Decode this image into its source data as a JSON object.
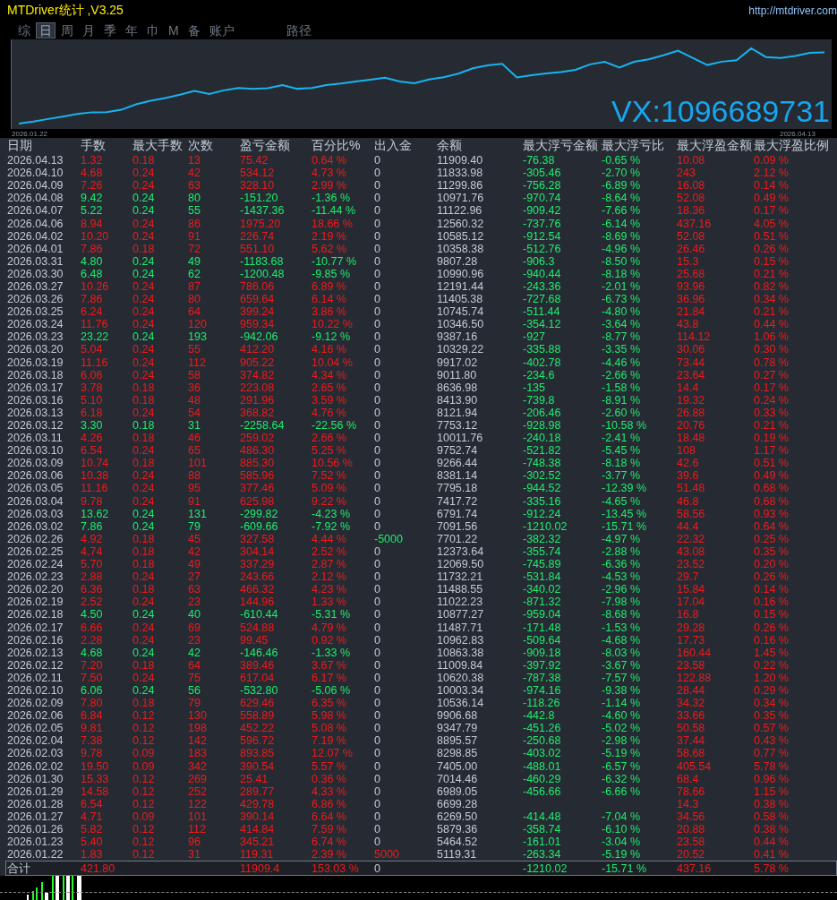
{
  "window": {
    "title": "MTDriver统计 ,V3.25",
    "url": "http://mtdriver.com"
  },
  "tabs": [
    {
      "label": "综",
      "selected": false
    },
    {
      "label": "日",
      "selected": true
    },
    {
      "label": "周",
      "selected": false
    },
    {
      "label": "月",
      "selected": false
    },
    {
      "label": "季",
      "selected": false
    },
    {
      "label": "年",
      "selected": false
    },
    {
      "label": "巾",
      "selected": false
    },
    {
      "label": "M",
      "selected": false
    },
    {
      "label": "备",
      "selected": false
    },
    {
      "label": "账户",
      "selected": false
    }
  ],
  "path_label": "路径",
  "chart": {
    "start_label": "2026.01.22",
    "end_label": "2026.04.13",
    "contact": "VX:1096689731"
  },
  "table": {
    "columns": [
      "日期",
      "手数",
      "最大手数",
      "次数",
      "盈亏金额",
      "百分比%",
      "出入金",
      "余额",
      "最大浮亏金额",
      "最大浮亏比",
      "最大浮盈金额",
      "最大浮盈比例"
    ],
    "rows": [
      {
        "kind": "win",
        "cells": [
          "2026.04.13",
          "1.32",
          "0.18",
          "13",
          "75.42",
          "0.64 %",
          "0",
          "11909.40",
          "-76.38",
          "-0.65 %",
          "10.08",
          "0.09 %"
        ]
      },
      {
        "kind": "win",
        "cells": [
          "2026.04.10",
          "4.68",
          "0.24",
          "42",
          "534.12",
          "4.73 %",
          "0",
          "11833.98",
          "-305.46",
          "-2.70 %",
          "243",
          "2.12 %"
        ]
      },
      {
        "kind": "win",
        "cells": [
          "2026.04.09",
          "7.26",
          "0.24",
          "63",
          "328.10",
          "2.99 %",
          "0",
          "11299.86",
          "-756.28",
          "-6.89 %",
          "16.08",
          "0.14 %"
        ]
      },
      {
        "kind": "loss",
        "cells": [
          "2026.04.08",
          "9.42",
          "0.24",
          "80",
          "-151.20",
          "-1.36 %",
          "0",
          "10971.76",
          "-970.74",
          "-8.64 %",
          "52.08",
          "0.49 %"
        ]
      },
      {
        "kind": "loss",
        "cells": [
          "2026.04.07",
          "5.22",
          "0.24",
          "55",
          "-1437.36",
          "-11.44 %",
          "0",
          "11122.96",
          "-909.42",
          "-7.66 %",
          "18.36",
          "0.17 %"
        ]
      },
      {
        "kind": "win",
        "cells": [
          "2026.04.06",
          "8.94",
          "0.24",
          "86",
          "1975.20",
          "18.66 %",
          "0",
          "12560.32",
          "-737.76",
          "-6.14 %",
          "437.16",
          "4.05 %"
        ]
      },
      {
        "kind": "win",
        "cells": [
          "2026.04.02",
          "10.20",
          "0.24",
          "91",
          "226.74",
          "2.19 %",
          "0",
          "10585.12",
          "-912.54",
          "-8.69 %",
          "52.08",
          "0.51 %"
        ]
      },
      {
        "kind": "win",
        "cells": [
          "2026.04.01",
          "7.86",
          "0.18",
          "72",
          "551.10",
          "5.62 %",
          "0",
          "10358.38",
          "-512.76",
          "-4.96 %",
          "26.46",
          "0.26 %"
        ]
      },
      {
        "kind": "loss",
        "cells": [
          "2026.03.31",
          "4.80",
          "0.24",
          "49",
          "-1183.68",
          "-10.77 %",
          "0",
          "9807.28",
          "-906.3",
          "-8.50 %",
          "15.3",
          "0.15 %"
        ]
      },
      {
        "kind": "loss",
        "cells": [
          "2026.03.30",
          "6.48",
          "0.24",
          "62",
          "-1200.48",
          "-9.85 %",
          "0",
          "10990.96",
          "-940.44",
          "-8.18 %",
          "25.68",
          "0.21 %"
        ]
      },
      {
        "kind": "win",
        "cells": [
          "2026.03.27",
          "10.26",
          "0.24",
          "87",
          "786.06",
          "6.89 %",
          "0",
          "12191.44",
          "-243.36",
          "-2.01 %",
          "93.96",
          "0.82 %"
        ]
      },
      {
        "kind": "win",
        "cells": [
          "2026.03.26",
          "7.86",
          "0.24",
          "80",
          "659.64",
          "6.14 %",
          "0",
          "11405.38",
          "-727.68",
          "-6.73 %",
          "36.96",
          "0.34 %"
        ]
      },
      {
        "kind": "win",
        "cells": [
          "2026.03.25",
          "6.24",
          "0.24",
          "64",
          "399.24",
          "3.86 %",
          "0",
          "10745.74",
          "-511.44",
          "-4.80 %",
          "21.84",
          "0.21 %"
        ]
      },
      {
        "kind": "win",
        "cells": [
          "2026.03.24",
          "11.76",
          "0.24",
          "120",
          "959.34",
          "10.22 %",
          "0",
          "10346.50",
          "-354.12",
          "-3.64 %",
          "43.8",
          "0.44 %"
        ]
      },
      {
        "kind": "loss",
        "cells": [
          "2026.03.23",
          "23.22",
          "0.24",
          "193",
          "-942.06",
          "-9.12 %",
          "0",
          "9387.16",
          "-927",
          "-8.77 %",
          "114.12",
          "1.06 %"
        ]
      },
      {
        "kind": "win",
        "cells": [
          "2026.03.20",
          "5.04",
          "0.24",
          "55",
          "412.20",
          "4.16 %",
          "0",
          "10329.22",
          "-335.88",
          "-3.35 %",
          "30.06",
          "0.30 %"
        ]
      },
      {
        "kind": "win",
        "cells": [
          "2026.03.19",
          "11.16",
          "0.24",
          "112",
          "905.22",
          "10.04 %",
          "0",
          "9917.02",
          "-402.78",
          "-4.46 %",
          "73.44",
          "0.78 %"
        ]
      },
      {
        "kind": "win",
        "cells": [
          "2026.03.18",
          "6.06",
          "0.24",
          "58",
          "374.82",
          "4.34 %",
          "0",
          "9011.80",
          "-234.6",
          "-2.66 %",
          "23.64",
          "0.27 %"
        ]
      },
      {
        "kind": "win",
        "cells": [
          "2026.03.17",
          "3.78",
          "0.18",
          "36",
          "223.08",
          "2.65 %",
          "0",
          "8636.98",
          "-135",
          "-1.58 %",
          "14.4",
          "0.17 %"
        ]
      },
      {
        "kind": "win",
        "cells": [
          "2026.03.16",
          "5.10",
          "0.18",
          "48",
          "291.96",
          "3.59 %",
          "0",
          "8413.90",
          "-739.8",
          "-8.91 %",
          "19.32",
          "0.24 %"
        ]
      },
      {
        "kind": "win",
        "cells": [
          "2026.03.13",
          "6.18",
          "0.24",
          "54",
          "368.82",
          "4.76 %",
          "0",
          "8121.94",
          "-206.46",
          "-2.60 %",
          "26.88",
          "0.33 %"
        ]
      },
      {
        "kind": "loss",
        "cells": [
          "2026.03.12",
          "3.30",
          "0.18",
          "31",
          "-2258.64",
          "-22.56 %",
          "0",
          "7753.12",
          "-928.98",
          "-10.58 %",
          "20.76",
          "0.21 %"
        ]
      },
      {
        "kind": "win",
        "cells": [
          "2026.03.11",
          "4.26",
          "0.18",
          "46",
          "259.02",
          "2.66 %",
          "0",
          "10011.76",
          "-240.18",
          "-2.41 %",
          "18.48",
          "0.19 %"
        ]
      },
      {
        "kind": "win",
        "cells": [
          "2026.03.10",
          "6.54",
          "0.24",
          "65",
          "486.30",
          "5.25 %",
          "0",
          "9752.74",
          "-521.82",
          "-5.45 %",
          "108",
          "1.17 %"
        ]
      },
      {
        "kind": "win",
        "cells": [
          "2026.03.09",
          "10.74",
          "0.18",
          "101",
          "885.30",
          "10.56 %",
          "0",
          "9266.44",
          "-748.38",
          "-8.18 %",
          "42.6",
          "0.51 %"
        ]
      },
      {
        "kind": "win",
        "cells": [
          "2026.03.06",
          "10.38",
          "0.24",
          "88",
          "585.96",
          "7.52 %",
          "0",
          "8381.14",
          "-302.52",
          "-3.77 %",
          "39.6",
          "0.49 %"
        ]
      },
      {
        "kind": "win",
        "cells": [
          "2026.03.05",
          "11.16",
          "0.24",
          "95",
          "377.46",
          "5.09 %",
          "0",
          "7795.18",
          "-944.52",
          "-12.39 %",
          "51.48",
          "0.68 %"
        ]
      },
      {
        "kind": "win",
        "cells": [
          "2026.03.04",
          "9.78",
          "0.24",
          "91",
          "625.98",
          "9.22 %",
          "0",
          "7417.72",
          "-335.16",
          "-4.65 %",
          "46.8",
          "0.68 %"
        ]
      },
      {
        "kind": "loss",
        "cells": [
          "2026.03.03",
          "13.62",
          "0.24",
          "131",
          "-299.82",
          "-4.23 %",
          "0",
          "6791.74",
          "-912.24",
          "-13.45 %",
          "58.56",
          "0.93 %"
        ]
      },
      {
        "kind": "loss",
        "cells": [
          "2026.03.02",
          "7.86",
          "0.24",
          "79",
          "-609.66",
          "-7.92 %",
          "0",
          "7091.56",
          "-1210.02",
          "-15.71 %",
          "44.4",
          "0.64 %"
        ]
      },
      {
        "kind": "win",
        "color": "#1ded6c",
        "cells": [
          "2026.02.26",
          "4.92",
          "0.18",
          "45",
          "327.58",
          "4.44 %",
          "-5000",
          "7701.22",
          "-382.32",
          "-4.97 %",
          "22.32",
          "0.25 %"
        ]
      },
      {
        "kind": "win",
        "cells": [
          "2026.02.25",
          "4.74",
          "0.18",
          "42",
          "304.14",
          "2.52 %",
          "0",
          "12373.64",
          "-355.74",
          "-2.88 %",
          "43.08",
          "0.35 %"
        ]
      },
      {
        "kind": "win",
        "cells": [
          "2026.02.24",
          "5.70",
          "0.18",
          "49",
          "337.29",
          "2.87 %",
          "0",
          "12069.50",
          "-745.89",
          "-6.36 %",
          "23.52",
          "0.20 %"
        ]
      },
      {
        "kind": "win",
        "cells": [
          "2026.02.23",
          "2.88",
          "0.24",
          "27",
          "243.66",
          "2.12 %",
          "0",
          "11732.21",
          "-531.84",
          "-4.53 %",
          "29.7",
          "0.26 %"
        ]
      },
      {
        "kind": "win",
        "cells": [
          "2026.02.20",
          "6.36",
          "0.18",
          "63",
          "466.32",
          "4.23 %",
          "0",
          "11488.55",
          "-340.02",
          "-2.96 %",
          "15.84",
          "0.14 %"
        ]
      },
      {
        "kind": "win",
        "cells": [
          "2026.02.19",
          "2.52",
          "0.24",
          "23",
          "144.96",
          "1.33 %",
          "0",
          "11022.23",
          "-871.32",
          "-7.98 %",
          "17.04",
          "0.16 %"
        ]
      },
      {
        "kind": "loss",
        "cells": [
          "2026.02.18",
          "4.50",
          "0.24",
          "40",
          "-610.44",
          "-5.31 %",
          "0",
          "10877.27",
          "-959.04",
          "-8.68 %",
          "16.8",
          "0.15 %"
        ]
      },
      {
        "kind": "win",
        "cells": [
          "2026.02.17",
          "6.66",
          "0.24",
          "69",
          "524.88",
          "4.79 %",
          "0",
          "11487.71",
          "-171.48",
          "-1.53 %",
          "29.28",
          "0.26 %"
        ]
      },
      {
        "kind": "win",
        "cells": [
          "2026.02.16",
          "2.28",
          "0.24",
          "23",
          "99.45",
          "0.92 %",
          "0",
          "10962.83",
          "-509.64",
          "-4.68 %",
          "17.73",
          "0.16 %"
        ]
      },
      {
        "kind": "loss",
        "cells": [
          "2026.02.13",
          "4.68",
          "0.24",
          "42",
          "-146.46",
          "-1.33 %",
          "0",
          "10863.38",
          "-909.18",
          "-8.03 %",
          "160.44",
          "1.45 %"
        ]
      },
      {
        "kind": "win",
        "cells": [
          "2026.02.12",
          "7.20",
          "0.18",
          "64",
          "389.46",
          "3.67 %",
          "0",
          "11009.84",
          "-397.92",
          "-3.67 %",
          "23.58",
          "0.22 %"
        ]
      },
      {
        "kind": "win",
        "cells": [
          "2026.02.11",
          "7.50",
          "0.24",
          "75",
          "617.04",
          "6.17 %",
          "0",
          "10620.38",
          "-787.38",
          "-7.57 %",
          "122.88",
          "1.20 %"
        ]
      },
      {
        "kind": "loss",
        "cells": [
          "2026.02.10",
          "6.06",
          "0.24",
          "56",
          "-532.80",
          "-5.06 %",
          "0",
          "10003.34",
          "-974.16",
          "-9.38 %",
          "28.44",
          "0.29 %"
        ]
      },
      {
        "kind": "win",
        "cells": [
          "2026.02.09",
          "7.80",
          "0.18",
          "79",
          "629.46",
          "6.35 %",
          "0",
          "10536.14",
          "-118.26",
          "-1.14 %",
          "34.32",
          "0.34 %"
        ]
      },
      {
        "kind": "win",
        "cells": [
          "2026.02.06",
          "6.84",
          "0.12",
          "130",
          "558.89",
          "5.98 %",
          "0",
          "9906.68",
          "-442.8",
          "-4.60 %",
          "33.66",
          "0.35 %"
        ]
      },
      {
        "kind": "win",
        "cells": [
          "2026.02.05",
          "9.81",
          "0.12",
          "198",
          "452.22",
          "5.08 %",
          "0",
          "9347.79",
          "-451.26",
          "-5.02 %",
          "50.58",
          "0.57 %"
        ]
      },
      {
        "kind": "win",
        "cells": [
          "2026.02.04",
          "7.38",
          "0.12",
          "142",
          "596.72",
          "7.19 %",
          "0",
          "8895.57",
          "-250.68",
          "-2.98 %",
          "37.44",
          "0.43 %"
        ]
      },
      {
        "kind": "win",
        "cells": [
          "2026.02.03",
          "9.78",
          "0.09",
          "183",
          "893.85",
          "12.07 %",
          "0",
          "8298.85",
          "-403.02",
          "-5.19 %",
          "58.68",
          "0.77 %"
        ]
      },
      {
        "kind": "win",
        "cells": [
          "2026.02.02",
          "19.50",
          "0.09",
          "342",
          "390.54",
          "5.57 %",
          "0",
          "7405.00",
          "-488.01",
          "-6.57 %",
          "405.54",
          "5.78 %"
        ]
      },
      {
        "kind": "win",
        "cells": [
          "2026.01.30",
          "15.33",
          "0.12",
          "269",
          "25.41",
          "0.36 %",
          "0",
          "7014.46",
          "-460.29",
          "-6.32 %",
          "68.4",
          "0.96 %"
        ]
      },
      {
        "kind": "win",
        "cells": [
          "2026.01.29",
          "14.58",
          "0.12",
          "252",
          "289.77",
          "4.33 %",
          "0",
          "6989.05",
          "-456.66",
          "-6.66 %",
          "78.66",
          "1.15 %"
        ]
      },
      {
        "kind": "win",
        "cells": [
          "2026.01.28",
          "6.54",
          "0.12",
          "122",
          "429.78",
          "6.86 %",
          "0",
          "6699.28",
          null,
          null,
          "14.3",
          "0.38 %"
        ]
      },
      {
        "kind": "win",
        "cells": [
          "2026.01.27",
          "4.71",
          "0.09",
          "101",
          "390.14",
          "6.64 %",
          "0",
          "6269.50",
          "-414.48",
          "-7.04 %",
          "34.56",
          "0.58 %"
        ]
      },
      {
        "kind": "win",
        "cells": [
          "2026.01.26",
          "5.82",
          "0.12",
          "112",
          "414.84",
          "7.59 %",
          "0",
          "5879.36",
          "-358.74",
          "-6.10 %",
          "20.88",
          "0.38 %"
        ]
      },
      {
        "kind": "win",
        "cells": [
          "2026.01.23",
          "5.40",
          "0.12",
          "96",
          "345.21",
          "6.74 %",
          "0",
          "5464.52",
          "-161.01",
          "-3.04 %",
          "23.58",
          "0.44 %"
        ]
      },
      {
        "kind": "win",
        "color": "#f01a1a",
        "cells": [
          "2026.01.22",
          "1.83",
          "0.12",
          "31",
          "119.31",
          "2.39 %",
          "5000",
          "5119.31",
          "-263.34",
          "-5.19 %",
          "20.52",
          "0.41 %"
        ]
      }
    ],
    "total": {
      "kind": "win",
      "cells": [
        "合计",
        "421.80",
        null,
        null,
        "11909.4",
        "153.03 %",
        "0",
        null,
        "-1210.02",
        "-15.71 %",
        "437.16",
        "5.78 %"
      ]
    }
  }
}
